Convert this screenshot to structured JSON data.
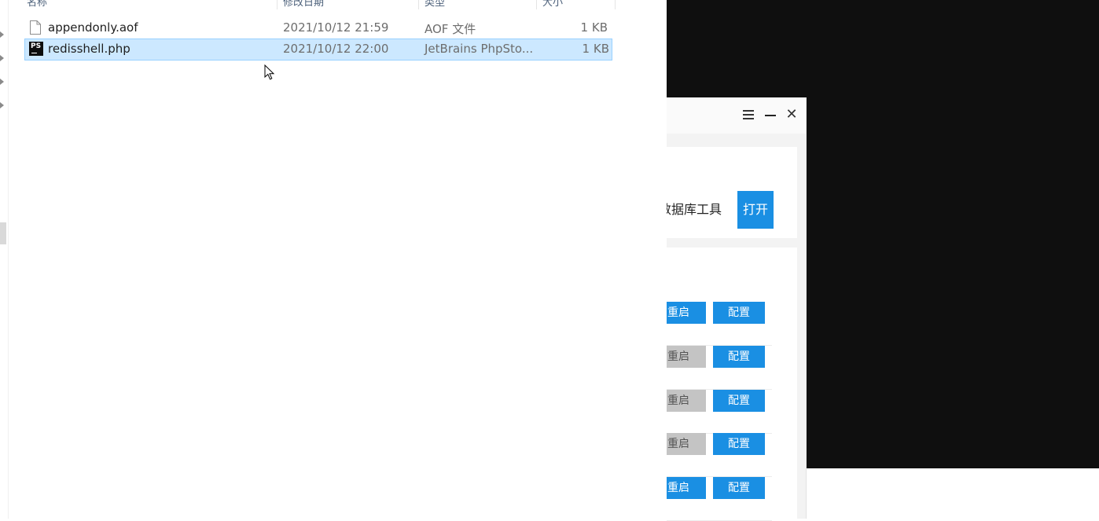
{
  "explorer": {
    "columns": [
      {
        "label": "名称"
      },
      {
        "label": "修改日期"
      },
      {
        "label": "类型"
      },
      {
        "label": "大小"
      }
    ],
    "files": [
      {
        "name": "appendonly.aof",
        "date": "2021/10/12 21:59",
        "type": "AOF 文件",
        "size": "1 KB",
        "icon": "generic-file-icon",
        "selected": false
      },
      {
        "name": "redisshell.php",
        "date": "2021/10/12 22:00",
        "type": "JetBrains PhpSto...",
        "size": "1 KB",
        "icon": "phpstorm-file-icon",
        "selected": true
      }
    ]
  },
  "app": {
    "titlebar": {
      "menu_icon": "menu-icon",
      "minimize_icon": "minimize-icon",
      "close_icon": "close-icon",
      "close_glyph": "✕"
    },
    "db_tool_text": "数据库工具",
    "open_label": "打开",
    "services": [
      {
        "restart_label": "重启",
        "config_label": "配置",
        "restart_active": true
      },
      {
        "restart_label": "重启",
        "config_label": "配置",
        "restart_active": false
      },
      {
        "restart_label": "重启",
        "config_label": "配置",
        "restart_active": false
      },
      {
        "restart_label": "重启",
        "config_label": "配置",
        "restart_active": false
      },
      {
        "restart_label": "重启",
        "config_label": "配置",
        "restart_active": true
      }
    ],
    "accent_color": "#1a8fe3",
    "inactive_color": "#c4c4c4"
  },
  "colors": {
    "selection": "#cce8ff",
    "background_dark": "#0f0f0f"
  }
}
